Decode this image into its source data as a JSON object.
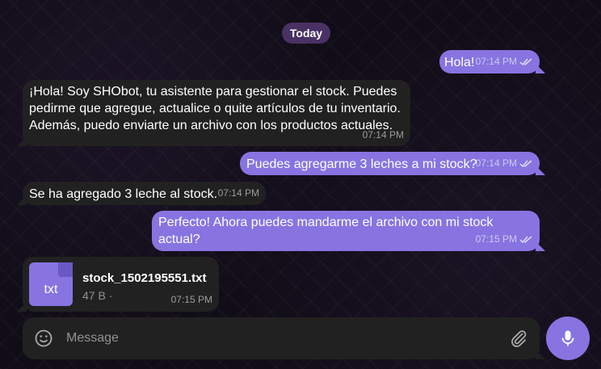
{
  "date_separator": "Today",
  "messages": [
    {
      "direction": "out",
      "text": "Hola!",
      "time": "07:14 PM",
      "status": "read"
    },
    {
      "direction": "in",
      "text": "¡Hola! Soy SHObot, tu asistente para gestionar el stock. Puedes pedirme que agregue, actualice o quite artículos de tu inventario. Además, puedo enviarte un archivo con los productos actuales.",
      "time": "07:14 PM"
    },
    {
      "direction": "out",
      "text": "Puedes agregarme 3 leches a mi stock?",
      "time": "07:14 PM",
      "status": "read"
    },
    {
      "direction": "in",
      "text": "Se ha agregado 3 leche al stock.",
      "time": "07:14 PM"
    },
    {
      "direction": "out",
      "text": "Perfecto! Ahora puedes mandarme el archivo con mi stock actual?",
      "time": "07:15 PM",
      "status": "read"
    }
  ],
  "file_message": {
    "direction": "in",
    "extension": "txt",
    "filename": "stock_1502195551.txt",
    "size": "47 B ·",
    "time": "07:15 PM"
  },
  "composer": {
    "placeholder": "Message",
    "emoji_icon": "smile-icon",
    "attach_icon": "paperclip-icon",
    "send_icon": "microphone-icon"
  },
  "colors": {
    "outgoing_bubble": "#8774e1",
    "incoming_bubble": "#212121",
    "background": "#110d18",
    "date_chip": "#5c3e7c"
  }
}
